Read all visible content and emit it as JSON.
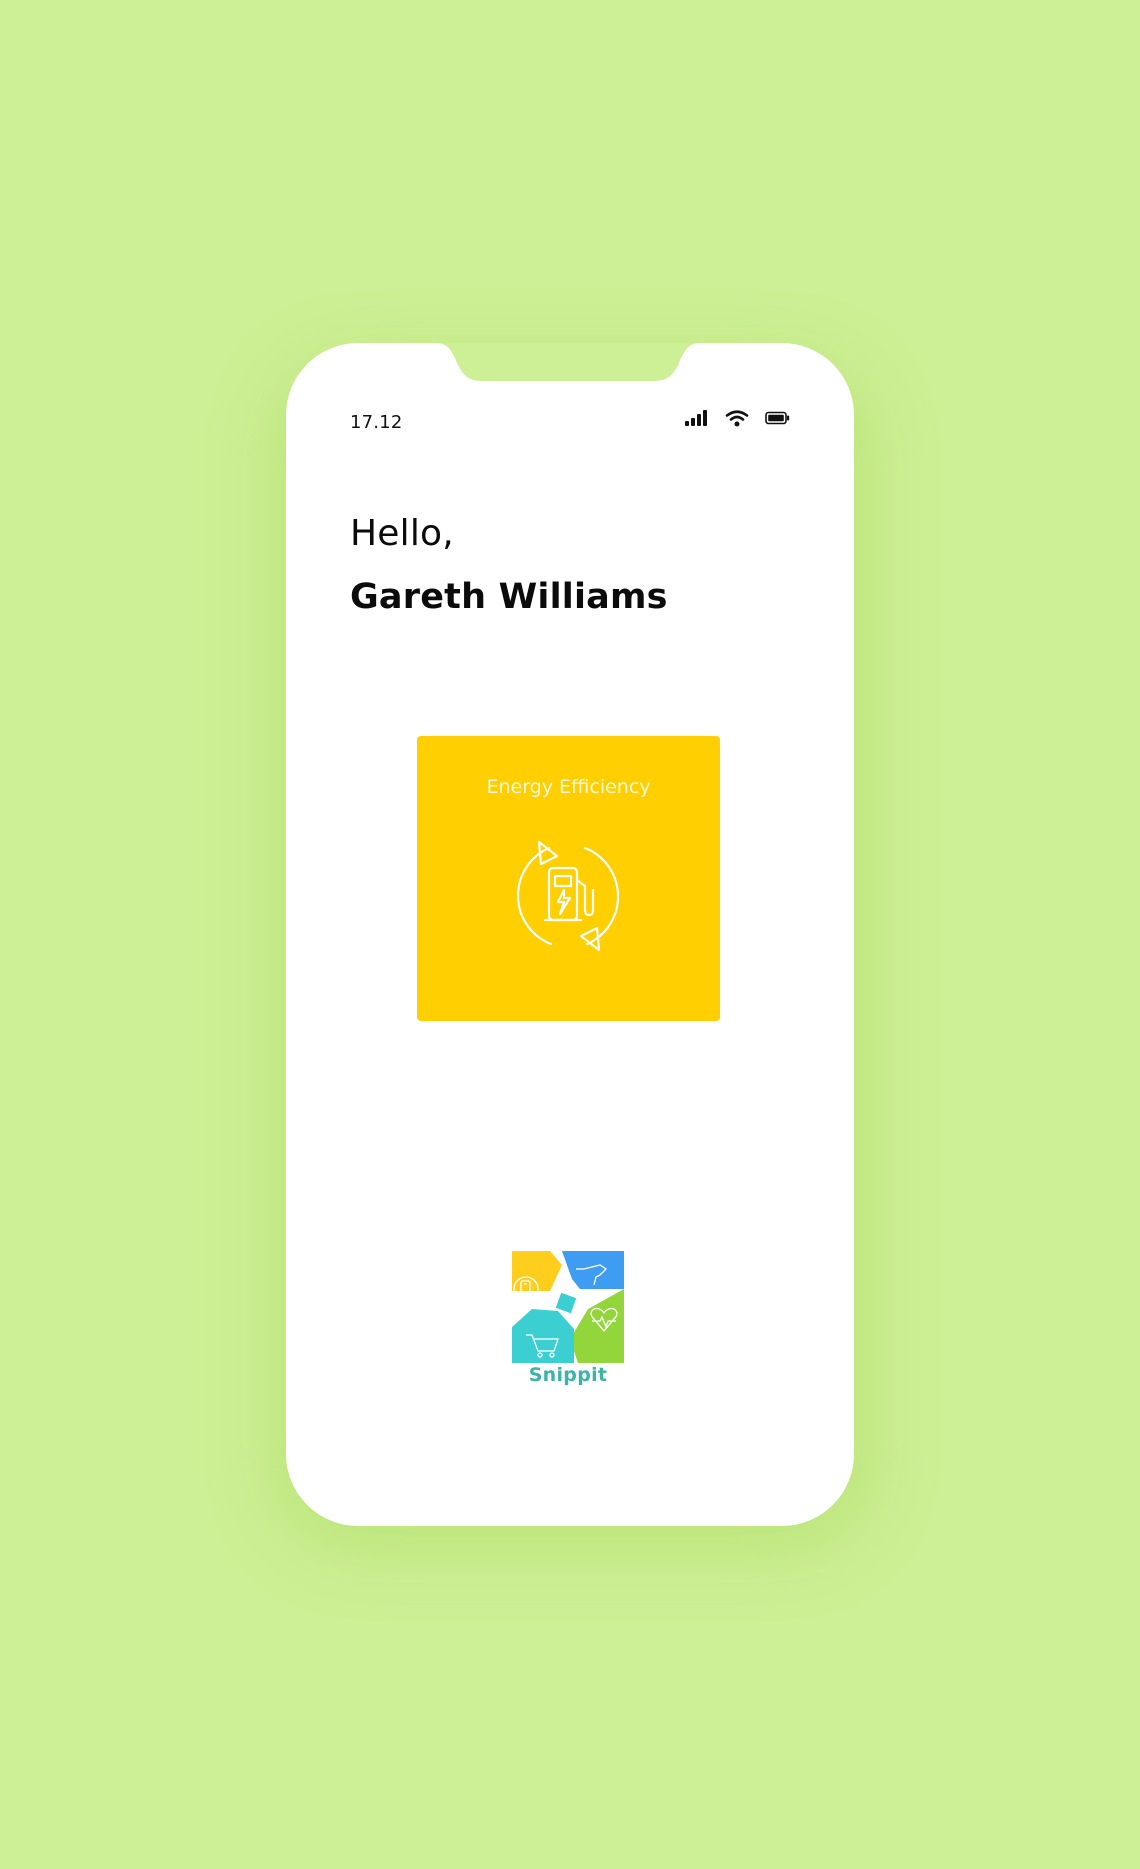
{
  "colors": {
    "background": "#cdef95",
    "phone": "#ffffff",
    "tile": "#ffcf01",
    "logo_yellow": "#ffcd1c",
    "logo_blue": "#3e9cf2",
    "logo_green": "#93d63c",
    "logo_teal": "#3ccfd2",
    "logo_text": "#3ab4a8"
  },
  "status_bar": {
    "time": "17.12",
    "icons": [
      "signal-icon",
      "wifi-icon",
      "battery-icon"
    ]
  },
  "greeting": {
    "hello": "Hello,",
    "name": "Gareth Williams"
  },
  "tile": {
    "label": "Energy Efficiency",
    "icon": "ev-charging-cycle-icon"
  },
  "brand": {
    "name": "Snippit",
    "icons": [
      "fuel-pump-icon",
      "drill-icon",
      "heart-pulse-icon",
      "shopping-cart-icon"
    ]
  }
}
